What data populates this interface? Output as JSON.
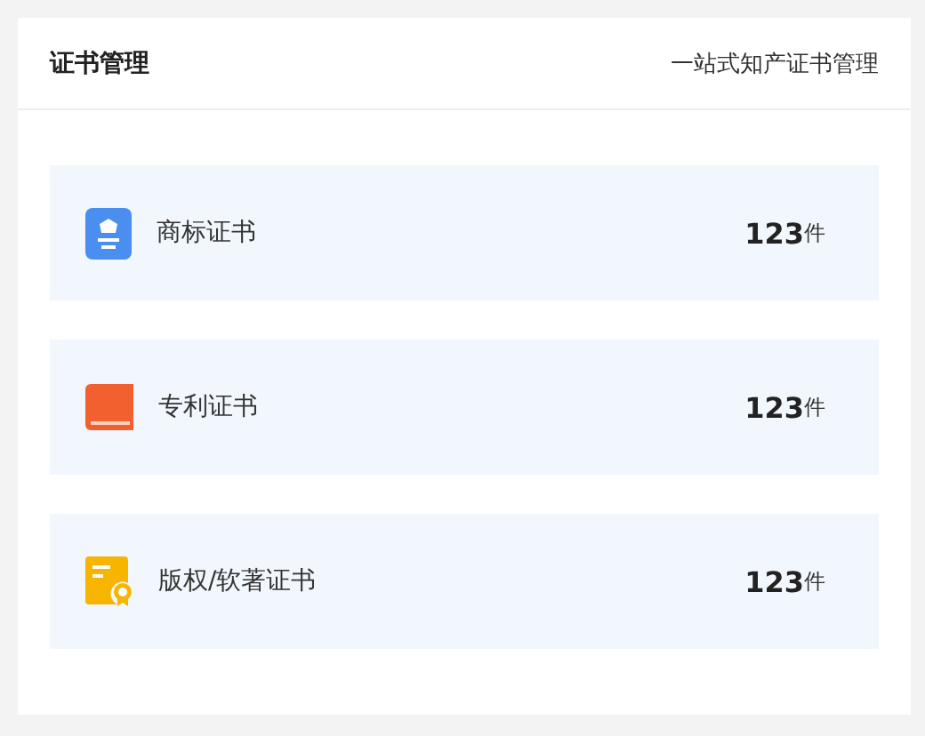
{
  "header": {
    "title": "证书管理",
    "subtitle": "一站式知产证书管理"
  },
  "items": [
    {
      "kind": "trademark",
      "label": "商标证书",
      "count": "123",
      "unit": "件"
    },
    {
      "kind": "patent",
      "label": "专利证书",
      "count": "123",
      "unit": "件"
    },
    {
      "kind": "copyright",
      "label": "版权/软著证书",
      "count": "123",
      "unit": "件"
    }
  ]
}
